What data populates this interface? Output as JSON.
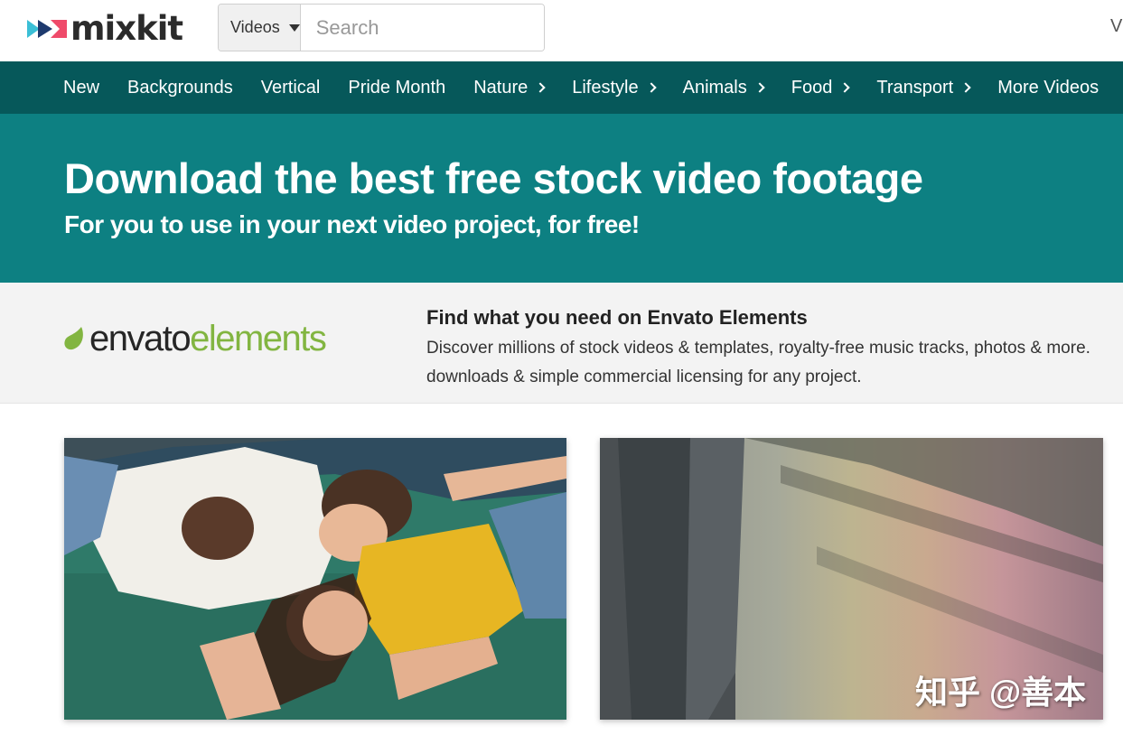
{
  "header": {
    "logo_text": "mixkit",
    "search_type": "Videos",
    "search_placeholder": "Search",
    "right_text": "V"
  },
  "nav": {
    "items": [
      {
        "label": "New",
        "has_chevron": false
      },
      {
        "label": "Backgrounds",
        "has_chevron": false
      },
      {
        "label": "Vertical",
        "has_chevron": false
      },
      {
        "label": "Pride Month",
        "has_chevron": false
      },
      {
        "label": "Nature",
        "has_chevron": true
      },
      {
        "label": "Lifestyle",
        "has_chevron": true
      },
      {
        "label": "Animals",
        "has_chevron": true
      },
      {
        "label": "Food",
        "has_chevron": true
      },
      {
        "label": "Transport",
        "has_chevron": true
      },
      {
        "label": "More Videos",
        "has_chevron": false
      }
    ]
  },
  "hero": {
    "title": "Download the best free stock video footage",
    "subtitle": "For you to use in your next video project, for free!"
  },
  "envato": {
    "logo_word": "envato",
    "logo_suffix": "elements",
    "title": "Find what you need on Envato Elements",
    "desc_line1": "Discover millions of stock videos & templates, royalty-free music tracks, photos & more.",
    "desc_line2": "downloads & simple commercial licensing for any project."
  },
  "cards": [
    {
      "name": "video-card-women-lying"
    },
    {
      "name": "video-card-rainbow-street"
    }
  ],
  "watermark": "知乎 @善本",
  "colors": {
    "nav_bg": "#06585a",
    "hero_bg": "#0d8082",
    "envato_green": "#82b541",
    "banner_bg": "#f3f3f3"
  }
}
